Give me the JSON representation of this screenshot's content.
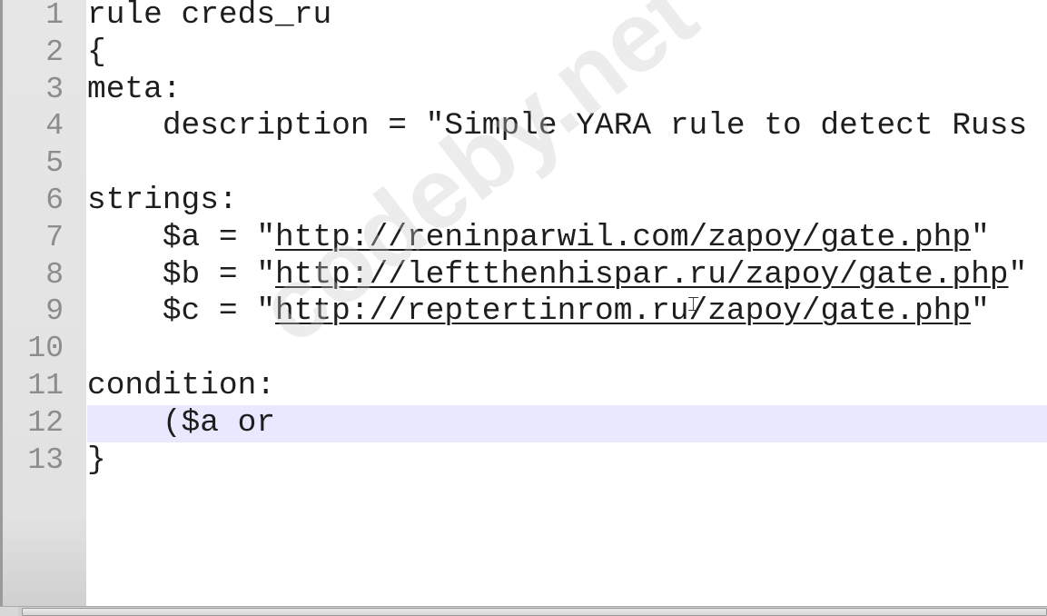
{
  "watermark": "codeby.net",
  "current_line": 12,
  "colors": {
    "current_line_bg": "#e8e8ff",
    "gutter_bg": "#e4e4e4",
    "line_number": "#8c8c8c",
    "text": "#1e1e1e"
  },
  "lines": [
    {
      "num": "1",
      "pre": "rule creds_ru",
      "link": "",
      "post": ""
    },
    {
      "num": "2",
      "pre": "{",
      "link": "",
      "post": ""
    },
    {
      "num": "3",
      "pre": "meta:",
      "link": "",
      "post": ""
    },
    {
      "num": "4",
      "pre": "    description = \"Simple YARA rule to detect Russ",
      "link": "",
      "post": ""
    },
    {
      "num": "5",
      "pre": "",
      "link": "",
      "post": ""
    },
    {
      "num": "6",
      "pre": "strings:",
      "link": "",
      "post": ""
    },
    {
      "num": "7",
      "pre": "    $a = \"",
      "link": "http://reninparwil.com/zapoy/gate.php",
      "post": "\""
    },
    {
      "num": "8",
      "pre": "    $b = \"",
      "link": "http://leftthenhispar.ru/zapoy/gate.php",
      "post": "\""
    },
    {
      "num": "9",
      "pre": "    $c = \"",
      "link": "http://reptertinrom.ru/zapoy/gate.php",
      "post": "\""
    },
    {
      "num": "10",
      "pre": "",
      "link": "",
      "post": ""
    },
    {
      "num": "11",
      "pre": "condition:",
      "link": "",
      "post": ""
    },
    {
      "num": "12",
      "pre": "    ($a or ",
      "link": "",
      "post": ""
    },
    {
      "num": "13",
      "pre": "}",
      "link": "",
      "post": ""
    }
  ]
}
